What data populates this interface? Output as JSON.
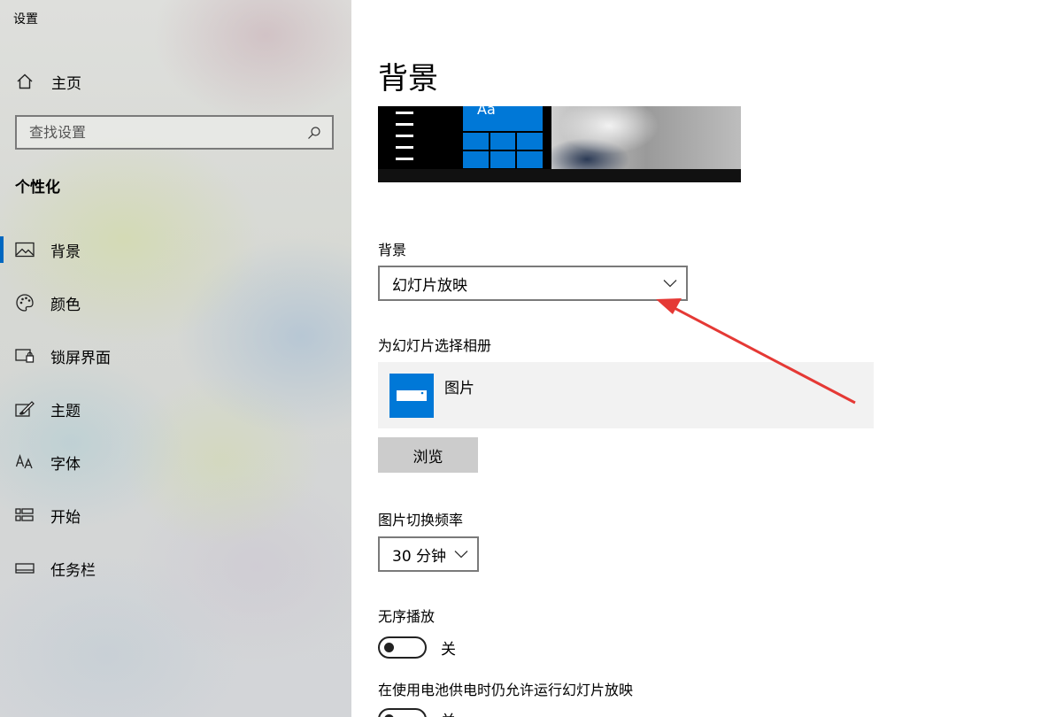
{
  "app": {
    "title": "设置"
  },
  "sidebar": {
    "home_label": "主页",
    "search_placeholder": "查找设置",
    "section_title": "个性化",
    "items": [
      {
        "label": "背景",
        "icon": "picture-icon",
        "active": true
      },
      {
        "label": "颜色",
        "icon": "palette-icon"
      },
      {
        "label": "锁屏界面",
        "icon": "lock-screen-icon"
      },
      {
        "label": "主题",
        "icon": "theme-brush-icon"
      },
      {
        "label": "字体",
        "icon": "font-icon"
      },
      {
        "label": "开始",
        "icon": "start-grid-icon"
      },
      {
        "label": "任务栏",
        "icon": "taskbar-icon"
      }
    ]
  },
  "main": {
    "page_title": "背景",
    "preview_tile_text": "Aa",
    "background": {
      "label": "背景",
      "value": "幻灯片放映"
    },
    "album": {
      "label": "为幻灯片选择相册",
      "name": "图片",
      "browse_label": "浏览"
    },
    "interval": {
      "label": "图片切换频率",
      "value": "30 分钟"
    },
    "shuffle": {
      "label": "无序播放",
      "state": "关"
    },
    "battery": {
      "label": "在使用电池供电时仍允许运行幻灯片放映",
      "state": "关"
    }
  },
  "colors": {
    "accent": "#0078d7",
    "annotation_arrow": "#e53935"
  }
}
